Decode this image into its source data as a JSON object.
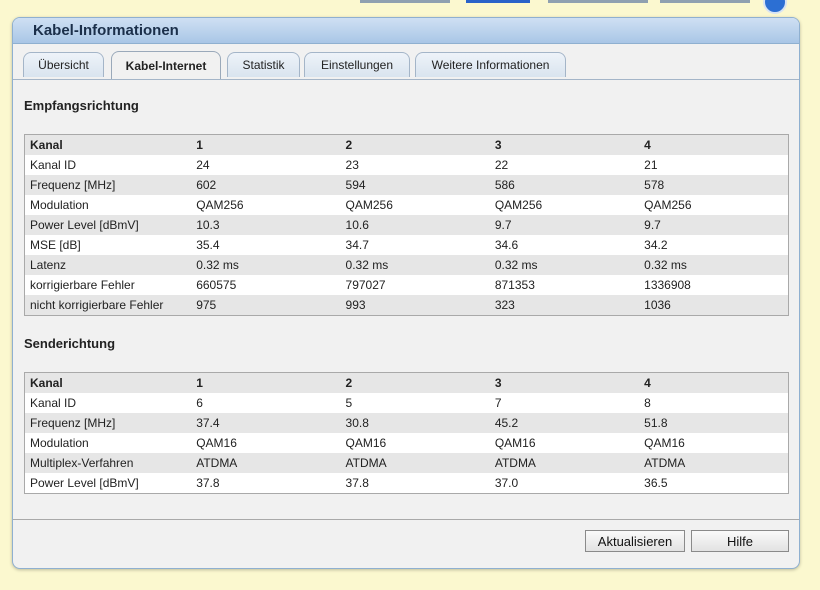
{
  "window": {
    "title": "Kabel-Informationen"
  },
  "tabs": [
    {
      "label": "Übersicht"
    },
    {
      "label": "Kabel-Internet"
    },
    {
      "label": "Statistik"
    },
    {
      "label": "Einstellungen"
    },
    {
      "label": "Weitere Informationen"
    }
  ],
  "downstream": {
    "title": "Empfangsrichtung",
    "header": [
      "Kanal",
      "1",
      "2",
      "3",
      "4"
    ],
    "rows": [
      [
        "Kanal ID",
        "24",
        "23",
        "22",
        "21"
      ],
      [
        "Frequenz [MHz]",
        "602",
        "594",
        "586",
        "578"
      ],
      [
        "Modulation",
        "QAM256",
        "QAM256",
        "QAM256",
        "QAM256"
      ],
      [
        "Power Level [dBmV]",
        "10.3",
        "10.6",
        "9.7",
        "9.7"
      ],
      [
        "MSE [dB]",
        "35.4",
        "34.7",
        "34.6",
        "34.2"
      ],
      [
        "Latenz",
        "0.32 ms",
        "0.32 ms",
        "0.32 ms",
        "0.32 ms"
      ],
      [
        "korrigierbare Fehler",
        "660575",
        "797027",
        "871353",
        "1336908"
      ],
      [
        "nicht korrigierbare Fehler",
        "975",
        "993",
        "323",
        "1036"
      ]
    ]
  },
  "upstream": {
    "title": "Senderichtung",
    "header": [
      "Kanal",
      "1",
      "2",
      "3",
      "4"
    ],
    "rows": [
      [
        "Kanal ID",
        "6",
        "5",
        "7",
        "8"
      ],
      [
        "Frequenz [MHz]",
        "37.4",
        "30.8",
        "45.2",
        "51.8"
      ],
      [
        "Modulation",
        "QAM16",
        "QAM16",
        "QAM16",
        "QAM16"
      ],
      [
        "Multiplex-Verfahren",
        "ATDMA",
        "ATDMA",
        "ATDMA",
        "ATDMA"
      ],
      [
        "Power Level [dBmV]",
        "37.8",
        "37.8",
        "37.0",
        "36.5"
      ]
    ]
  },
  "buttons": {
    "refresh": "Aktualisieren",
    "help": "Hilfe"
  },
  "colors": {
    "page_bg": "#fbf8cf",
    "titlebar": "#b7d0ea",
    "row_alt": "#e6e6e6"
  },
  "icons": {
    "top_right": "help-icon"
  }
}
